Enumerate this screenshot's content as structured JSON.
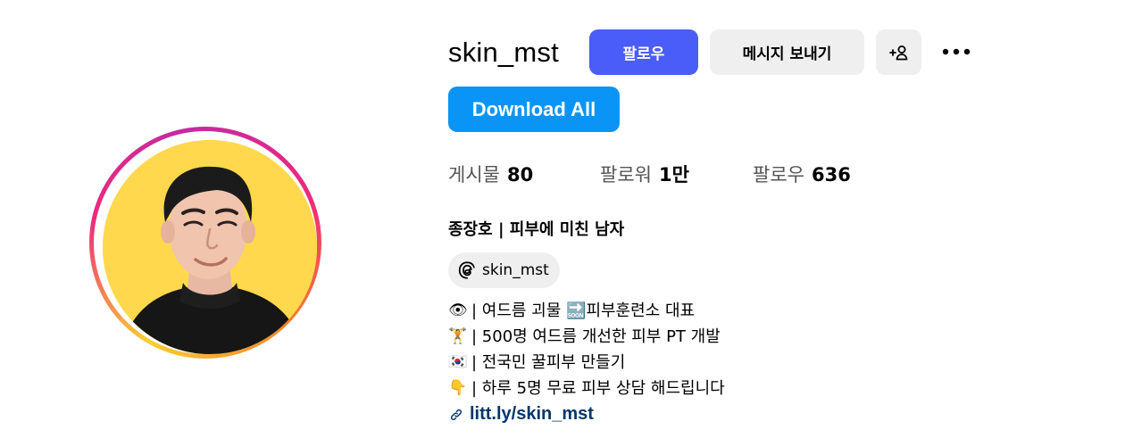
{
  "profile": {
    "username": "skin_mst",
    "avatar_background": "#ffd84d"
  },
  "actions": {
    "follow_label": "팔로우",
    "message_label": "메시지 보내기",
    "suggest_icon": "add-person-icon",
    "more_icon": "more-options-icon",
    "download_label": "Download All",
    "follow_color": "#4a5df9",
    "download_color": "#0a95f6"
  },
  "stats": {
    "posts_label": "게시물",
    "posts_value": "80",
    "followers_label": "팔로워",
    "followers_value": "1만",
    "following_label": "팔로우",
    "following_value": "636"
  },
  "bio": {
    "full_name": "종장호 | 피부에 미친 남자",
    "threads_handle": "skin_mst",
    "lines": [
      {
        "emoji": "👁",
        "text": "| 여드름 괴물 🔜피부훈련소 대표"
      },
      {
        "emoji": "🏋",
        "text": "| 500명 여드름 개선한 피부 PT 개발"
      },
      {
        "emoji": "🇰🇷",
        "text": "| 전국민 꿀피부 만들기"
      },
      {
        "emoji": "👇",
        "text": "| 하루 5명 무료 피부 상담 해드립니다"
      }
    ],
    "link": "litt.ly/skin_mst",
    "link_color": "#00376b"
  }
}
